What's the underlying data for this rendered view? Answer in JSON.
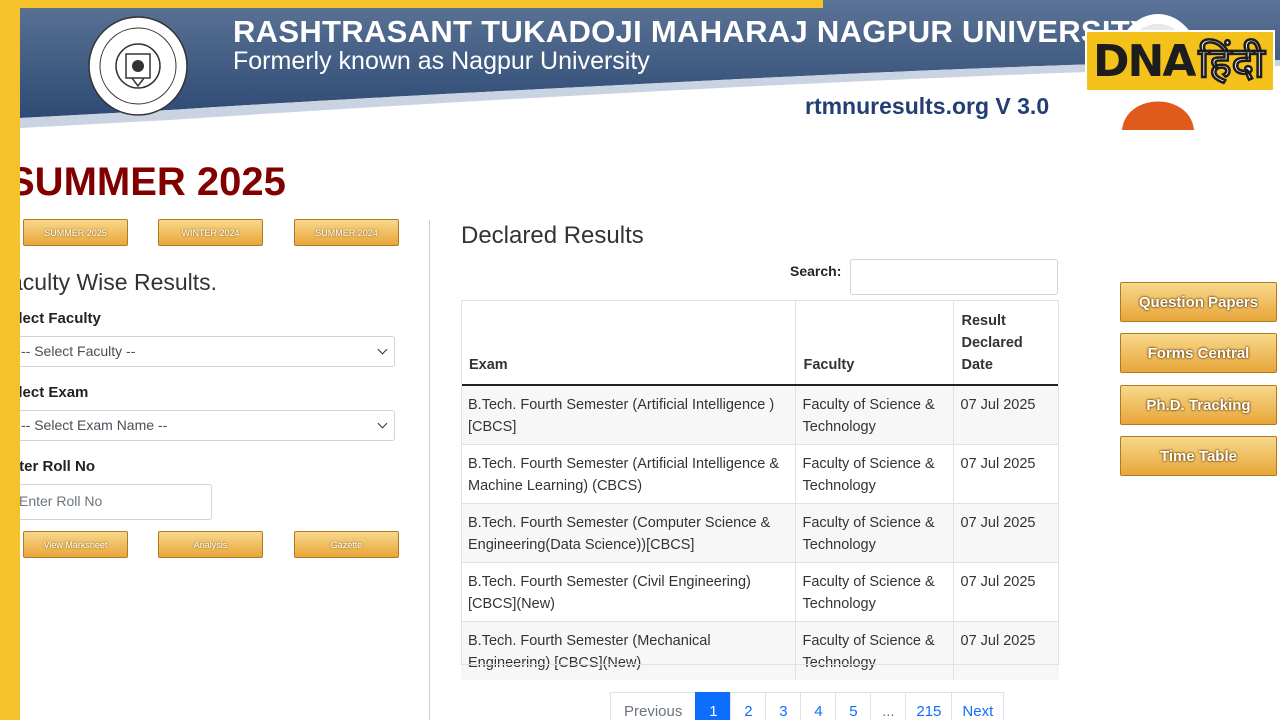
{
  "header": {
    "title": "RASHTRASANT TUKADOJI MAHARAJ NAGPUR UNIVERSITY",
    "subtitle": "Formerly known as Nagpur University",
    "site_version": "rtmnuresults.org  V 3.0",
    "seal_text": "SEAL OF RASHTRASANT TUKADOJI MAHARAJ NAGPUR UNIVERSITY"
  },
  "watermark": {
    "en": "DNA",
    "hi": "हिंदी"
  },
  "season_title": "SUMMER 2025",
  "season_tabs": [
    "SUMMER 2025",
    "WINTER 2024",
    "SUMMER 2024"
  ],
  "faculty_panel": {
    "title": "aculty Wise Results.",
    "faculty_label": "elect Faculty",
    "faculty_select": "-- Select Faculty --",
    "exam_label": "elect Exam",
    "exam_select": "-- Select Exam Name --",
    "roll_label": "nter Roll No",
    "roll_placeholder": "Enter Roll No",
    "actions": [
      "View Marksheet",
      "Analysis",
      "Gazette"
    ]
  },
  "declared": {
    "title": "Declared Results",
    "search_label": "Search:",
    "columns": [
      "Exam",
      "Faculty",
      "Result Declared Date"
    ],
    "rows": [
      {
        "exam": "B.Tech. Fourth Semester (Artificial Intelligence ) [CBCS]",
        "faculty": "Faculty of Science & Technology",
        "date": "07 Jul 2025"
      },
      {
        "exam": "B.Tech. Fourth Semester (Artificial Intelligence & Machine Learning) (CBCS)",
        "faculty": "Faculty of Science & Technology",
        "date": "07 Jul 2025"
      },
      {
        "exam": "B.Tech. Fourth Semester (Computer Science & Engineering(Data Science))[CBCS]",
        "faculty": "Faculty of Science & Technology",
        "date": "07 Jul 2025"
      },
      {
        "exam": "B.Tech. Fourth Semester (Civil Engineering) [CBCS](New)",
        "faculty": "Faculty of Science & Technology",
        "date": "07 Jul 2025"
      },
      {
        "exam": "B.Tech. Fourth Semester (Mechanical Engineering) [CBCS](New)",
        "faculty": "Faculty of Science & Technology",
        "date": "07 Jul 2025"
      }
    ],
    "pagination": {
      "previous": "Previous",
      "pages": [
        "1",
        "2",
        "3",
        "4",
        "5",
        "...",
        "215"
      ],
      "next": "Next",
      "active": "1"
    }
  },
  "side_links": [
    "Question Papers",
    "Forms Central",
    "Ph.D. Tracking",
    "Time Table"
  ],
  "colors": {
    "accent_gold": "#f6c22b",
    "banner_blue": "#3e5a84",
    "title_maroon": "#800000",
    "link_blue": "#0d6efd"
  }
}
